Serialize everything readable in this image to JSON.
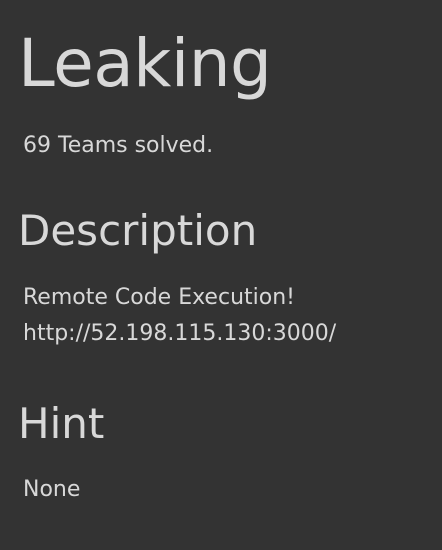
{
  "challenge": {
    "title": "Leaking",
    "solves": "69 Teams solved."
  },
  "description": {
    "heading": "Description",
    "line1": "Remote Code Execution!",
    "url": "http://52.198.115.130:3000/"
  },
  "hint": {
    "heading": "Hint",
    "text": "None"
  }
}
